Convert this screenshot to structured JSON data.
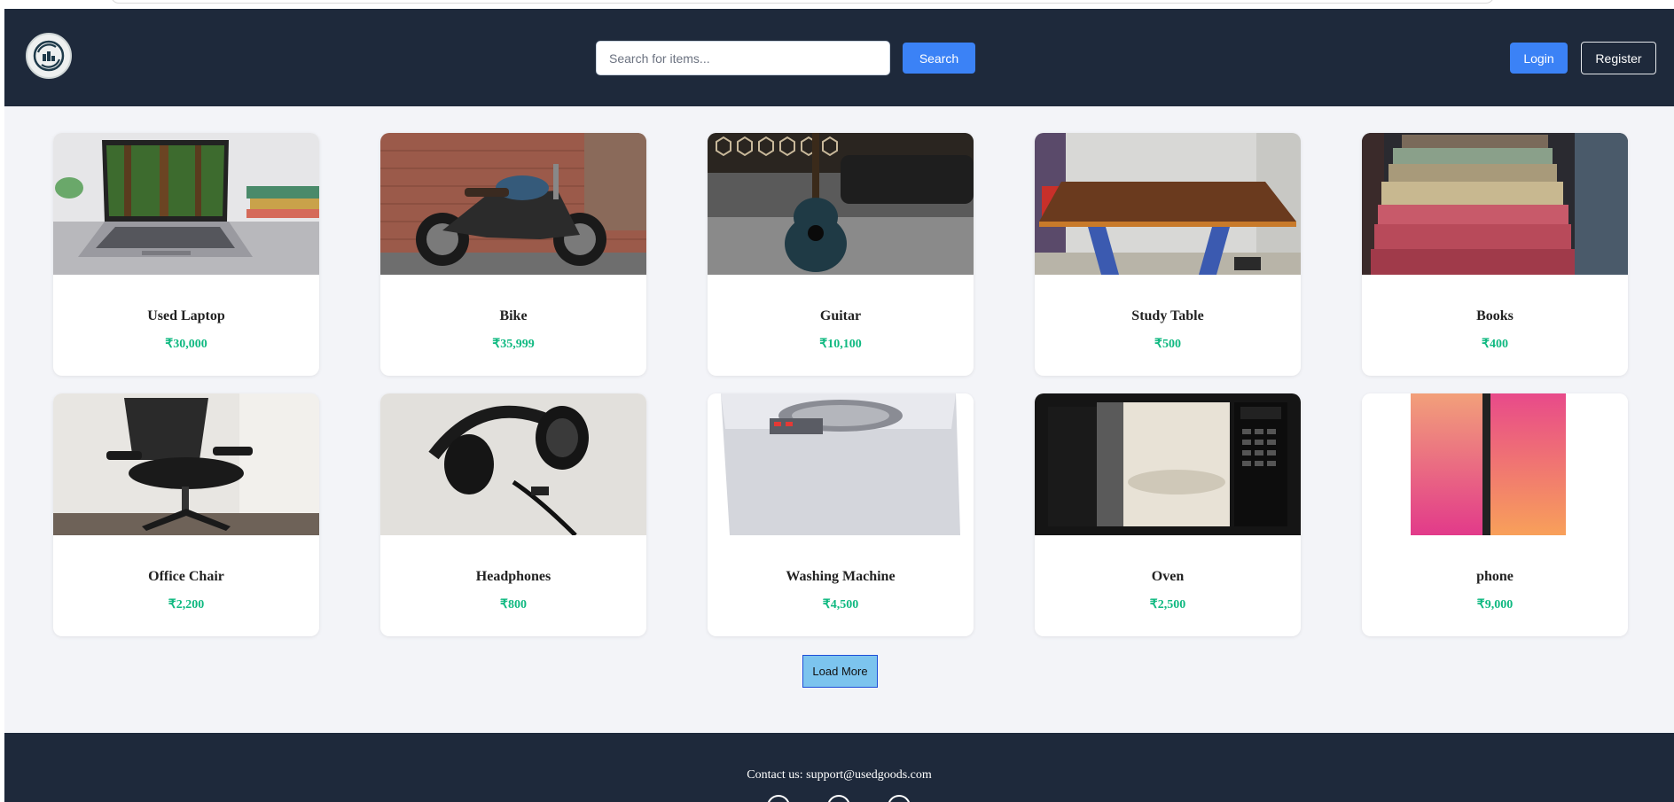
{
  "header": {
    "search_placeholder": "Search for items...",
    "search_label": "Search",
    "login_label": "Login",
    "register_label": "Register"
  },
  "products": [
    {
      "name": "Used Laptop",
      "price": "₹30,000",
      "image": "laptop"
    },
    {
      "name": "Bike",
      "price": "₹35,999",
      "image": "motorcycle"
    },
    {
      "name": "Guitar",
      "price": "₹10,100",
      "image": "guitar"
    },
    {
      "name": "Study Table",
      "price": "₹500",
      "image": "table"
    },
    {
      "name": "Books",
      "price": "₹400",
      "image": "books"
    },
    {
      "name": "Office Chair",
      "price": "₹2,200",
      "image": "chair"
    },
    {
      "name": "Headphones",
      "price": "₹800",
      "image": "headphones"
    },
    {
      "name": "Washing Machine",
      "price": "₹4,500",
      "image": "washing-machine"
    },
    {
      "name": "Oven",
      "price": "₹2,500",
      "image": "microwave"
    },
    {
      "name": "phone",
      "price": "₹9,000",
      "image": "phone"
    }
  ],
  "load_more_label": "Load More",
  "footer": {
    "contact": "Contact us: support@usedgoods.com"
  },
  "colors": {
    "header_bg": "#1e293b",
    "accent": "#3b82f6",
    "price": "#10b981"
  }
}
